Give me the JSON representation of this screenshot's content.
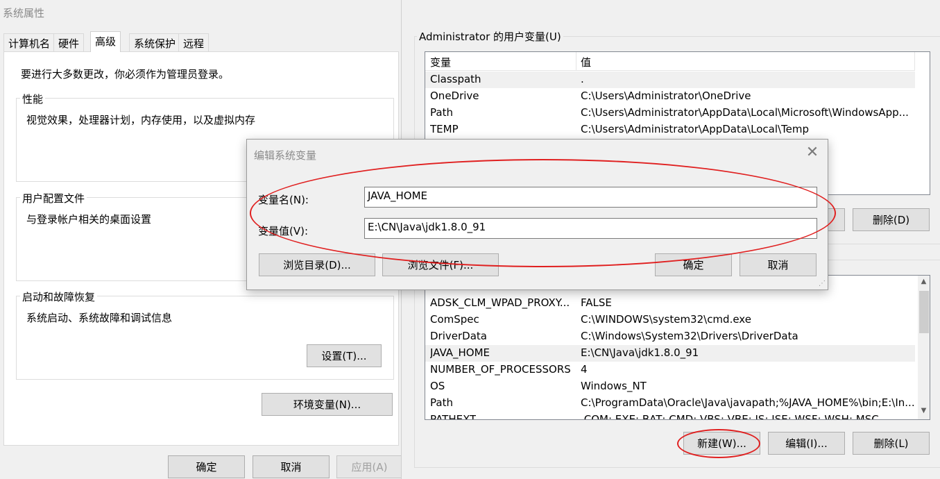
{
  "sys_props": {
    "title": "系统属性",
    "tabs": [
      "计算机名",
      "硬件",
      "高级",
      "系统保护",
      "远程"
    ],
    "admin_note": "要进行大多数更改，你必须作为管理员登录。",
    "performance": {
      "label": "性能",
      "desc": "视觉效果，处理器计划，内存使用，以及虚拟内存"
    },
    "user_profiles": {
      "label": "用户配置文件",
      "desc": "与登录帐户相关的桌面设置"
    },
    "startup": {
      "label": "启动和故障恢复",
      "desc": "系统启动、系统故障和调试信息",
      "settings_btn": "设置(T)..."
    },
    "env_btn": "环境变量(N)...",
    "ok": "确定",
    "cancel": "取消",
    "apply": "应用(A)"
  },
  "env_vars": {
    "user_group_label": "Administrator 的用户变量(U)",
    "header": {
      "var": "变量",
      "val": "值"
    },
    "user_rows": [
      {
        "name": "Classpath",
        "value": "."
      },
      {
        "name": "OneDrive",
        "value": "C:\\Users\\Administrator\\OneDrive"
      },
      {
        "name": "Path",
        "value": "C:\\Users\\Administrator\\AppData\\Local\\Microsoft\\WindowsApp..."
      },
      {
        "name": "TEMP",
        "value": "C:\\Users\\Administrator\\AppData\\Local\\Temp"
      }
    ],
    "user_delete_btn": "删除(D)",
    "sys_rows": [
      {
        "name": "ADSK_CLM_WPAD_PROXY...",
        "value": "FALSE"
      },
      {
        "name": "ComSpec",
        "value": "C:\\WINDOWS\\system32\\cmd.exe"
      },
      {
        "name": "DriverData",
        "value": "C:\\Windows\\System32\\Drivers\\DriverData"
      },
      {
        "name": "JAVA_HOME",
        "value": "E:\\CN\\Java\\jdk1.8.0_91"
      },
      {
        "name": "NUMBER_OF_PROCESSORS",
        "value": "4"
      },
      {
        "name": "OS",
        "value": "Windows_NT"
      },
      {
        "name": "Path",
        "value": "C:\\ProgramData\\Oracle\\Java\\javapath;%JAVA_HOME%\\bin;E:\\In..."
      },
      {
        "name": "PATHEXT",
        "value": ".COM;.EXE;.BAT;.CMD;.VBS;.VBE;.JS;.JSE;.WSF;.WSH;.MSC"
      }
    ],
    "sys_selected_index": 3,
    "new_btn": "新建(W)...",
    "edit_btn": "编辑(I)...",
    "delete_btn": "删除(L)"
  },
  "edit_dialog": {
    "title": "编辑系统变量",
    "close_symbol": "✕",
    "name_label": "变量名(N):",
    "name_value": "JAVA_HOME",
    "value_label": "变量值(V):",
    "value_value": "E:\\CN\\Java\\jdk1.8.0_91",
    "browse_dir": "浏览目录(D)...",
    "browse_file": "浏览文件(F)...",
    "ok": "确定",
    "cancel": "取消"
  },
  "colors": {
    "annotation_red": "#e02020",
    "window_bg": "#f0f0f0",
    "button_bg": "#e1e1e1"
  }
}
